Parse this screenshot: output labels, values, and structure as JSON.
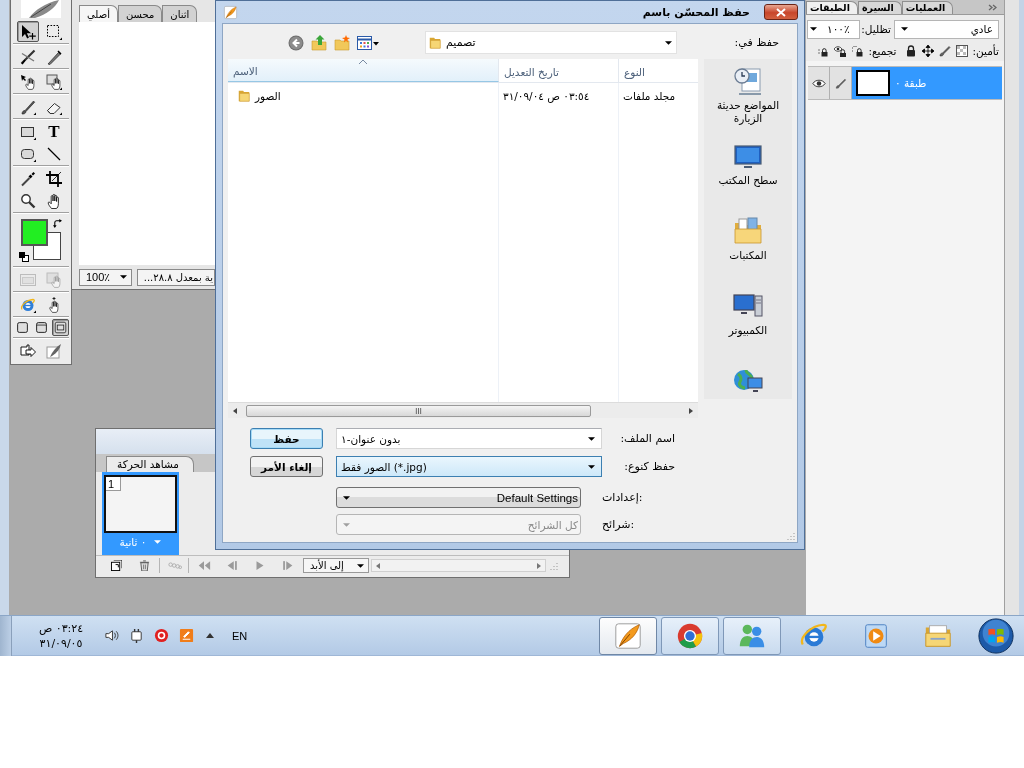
{
  "toolbox": {
    "tool_groups": [
      {
        "tools": [
          {
            "kind": "pointer",
            "selected": true,
            "disabled": false
          },
          {
            "kind": "marquee",
            "selected": false,
            "disabled": false
          }
        ]
      },
      {
        "tools": [
          {
            "kind": "scale",
            "selected": false,
            "disabled": false
          },
          {
            "kind": "knife",
            "selected": false,
            "disabled": false
          }
        ]
      },
      {
        "tools": [
          {
            "kind": "hand-arrow",
            "selected": false,
            "disabled": false
          },
          {
            "kind": "hand-square",
            "selected": false,
            "disabled": false
          }
        ]
      },
      {
        "tools": [
          {
            "kind": "brush",
            "selected": false,
            "disabled": false
          },
          {
            "kind": "eraser",
            "selected": false,
            "disabled": false
          }
        ]
      },
      {
        "tools": [
          {
            "kind": "rectangle",
            "selected": false,
            "disabled": false
          },
          {
            "kind": "text",
            "glyph": "T",
            "selected": false,
            "disabled": false
          },
          {
            "kind": "rounded",
            "selected": false,
            "disabled": false
          },
          {
            "kind": "line",
            "selected": false,
            "disabled": false
          }
        ]
      },
      {
        "tools": [
          {
            "kind": "eyedropper",
            "selected": false,
            "disabled": false
          },
          {
            "kind": "crop",
            "selected": false,
            "disabled": false
          },
          {
            "kind": "zoom",
            "selected": false,
            "disabled": false
          },
          {
            "kind": "hand",
            "selected": false,
            "disabled": false
          }
        ]
      }
    ],
    "swatches": [
      {
        "color": "#22ee22"
      },
      {
        "color": "#ffffff"
      }
    ],
    "view_groups": [
      {
        "tools": [
          {
            "kind": "hotspot",
            "selected": false,
            "disabled": true
          },
          {
            "kind": "slice-hand",
            "selected": false,
            "disabled": true
          }
        ]
      },
      {
        "tools": [
          {
            "kind": "browser",
            "selected": false,
            "disabled": false
          },
          {
            "kind": "hand-pointer",
            "selected": false,
            "disabled": false
          }
        ]
      },
      {
        "tools": [
          {
            "kind": "mode-standard",
            "selected": false,
            "disabled": false
          },
          {
            "kind": "mode-titled",
            "selected": false,
            "disabled": false
          },
          {
            "kind": "mode-full",
            "selected": true,
            "disabled": false
          }
        ]
      },
      {
        "tools": [
          {
            "kind": "export",
            "selected": false,
            "disabled": false
          },
          {
            "kind": "quill",
            "selected": false,
            "disabled": false
          }
        ]
      }
    ]
  },
  "document": {
    "tabs": [
      {
        "label": "اثنان",
        "selected": false
      },
      {
        "label": "محسن",
        "selected": false
      },
      {
        "label": "أصلي",
        "selected": true
      }
    ],
    "zoom": "100٪",
    "status": "ية بمعدل ٢٨.٨..."
  },
  "dialog": {
    "title": "حفظ المحسّن باسم",
    "save_in": {
      "label": "حفظ في:",
      "value": "تصميم"
    },
    "columns": [
      {
        "label": "النوع",
        "sorted": false
      },
      {
        "label": "تاريخ التعديل",
        "sorted": false
      },
      {
        "label": "الاسم",
        "sorted": true
      }
    ],
    "rows": [
      {
        "kind": "folder",
        "cells": [
          "مجلد ملفات",
          "٠٣:٥٤ ص ٣١/٠٩/٠٤",
          "الصور"
        ]
      }
    ],
    "places": [
      {
        "kind": "recent",
        "label": "المواضع حديثة الزيارة"
      },
      {
        "kind": "desktop",
        "label": "سطح المكتب"
      },
      {
        "kind": "libraries",
        "label": "المكتبات"
      },
      {
        "kind": "computer",
        "label": "الكمبيوتر"
      },
      {
        "kind": "network"
      }
    ],
    "fields": [
      {
        "kind": "combo",
        "label": "اسم الملف:",
        "value": "بدون عنوان-١",
        "focused": false,
        "disabled": false
      },
      {
        "kind": "combo",
        "label": "حفظ كنوع:",
        "value": "الصور فقط (*.jpg)",
        "focused": true,
        "disabled": false
      },
      {
        "kind": "dropdown",
        "label": "إعدادات:",
        "value": "Default Settings",
        "focused": false,
        "disabled": false
      },
      {
        "kind": "dropdown",
        "label": "شرائح:",
        "value": "كل الشرائح",
        "focused": false,
        "disabled": true
      }
    ],
    "buttons": [
      {
        "label": "حفظ",
        "default": true
      },
      {
        "label": "إلغاء الأمر",
        "default": false
      }
    ]
  },
  "layers_panel": {
    "tabs": [
      {
        "label": "العمليات",
        "selected": false
      },
      {
        "label": "السيرة",
        "selected": false
      },
      {
        "label": "الطبقات",
        "selected": true
      }
    ],
    "opacity": "١٠٠٪",
    "opacity_label": "تظليل:",
    "blend_mode": "عادي",
    "lock_label": "تأمين:",
    "group_label": "تجميع:",
    "layers": [
      {
        "name": "طبقة ٠",
        "selected": true,
        "visible": true
      }
    ]
  },
  "frames_panel": {
    "tab": "مشاهد الحركة",
    "frames": [
      {
        "number": "1",
        "delay": "٠ ثانية",
        "selected": true
      }
    ],
    "loop": "إلى الأبد"
  },
  "taskbar": {
    "time": "٠٣:٢٤ ص",
    "date": "٣١/٠٩/٠٥",
    "language": "EN",
    "apps": [
      {
        "kind": "feather",
        "running": true,
        "active": true
      },
      {
        "kind": "ball",
        "running": true,
        "active": false
      },
      {
        "kind": "people",
        "running": true,
        "active": false
      },
      {
        "kind": "e-globe",
        "running": false,
        "active": false
      },
      {
        "kind": "player",
        "running": false,
        "active": false
      },
      {
        "kind": "folder",
        "running": false,
        "active": false
      }
    ]
  }
}
